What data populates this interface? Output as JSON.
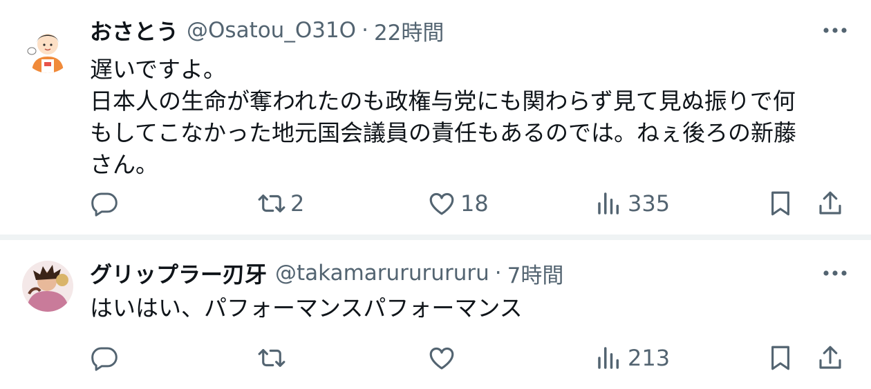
{
  "tweets": [
    {
      "display_name": "おさとう",
      "handle": "@Osatou_O31O",
      "separator": "·",
      "time": "22時間",
      "text": "遅いですよ。\n日本人の生命が奪われたのも政権与党にも関わらず見て見ぬ振りで何\nもしてこなかった地元国会議員の責任もあるのでは。ねぇ後ろの新藤\nさん。",
      "replies": "",
      "retweets": "2",
      "likes": "18",
      "views": "335"
    },
    {
      "display_name": "グリップラー刃牙",
      "handle": "@takamarururururu",
      "separator": "·",
      "time": "7時間",
      "text": "はいはい、パフォーマンスパフォーマンス",
      "replies": "",
      "retweets": "",
      "likes": "",
      "views": "213"
    }
  ],
  "icons": [
    "reply-icon",
    "retweet-icon",
    "like-icon",
    "views-icon",
    "bookmark-icon",
    "share-icon",
    "more-icon"
  ],
  "colors": {
    "text": "#0f1419",
    "secondary": "#536471",
    "divider": "#eff3f4"
  }
}
